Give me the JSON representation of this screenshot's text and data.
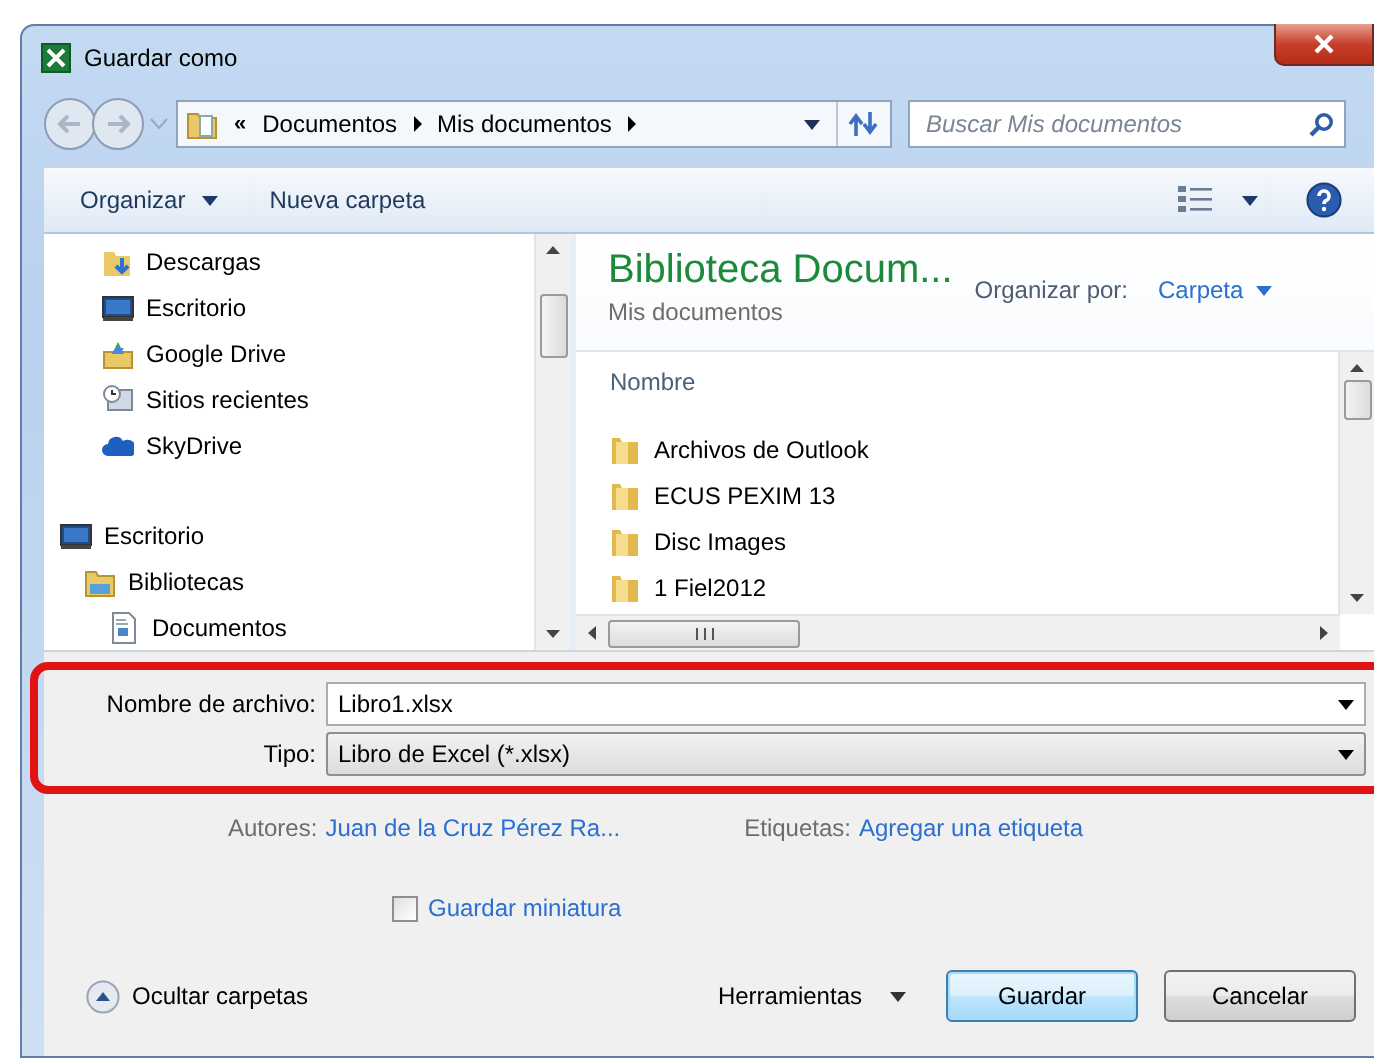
{
  "window": {
    "title": "Guardar como"
  },
  "address_bar": {
    "path": [
      "Documentos",
      "Mis documentos"
    ],
    "overflow": "«"
  },
  "search": {
    "placeholder": "Buscar Mis documentos"
  },
  "toolbar": {
    "organize": "Organizar",
    "new_folder": "Nueva carpeta"
  },
  "nav_favorites": [
    {
      "label": "Descargas",
      "kind": "downloads"
    },
    {
      "label": "Escritorio",
      "kind": "desktop"
    },
    {
      "label": "Google Drive",
      "kind": "drive"
    },
    {
      "label": "Sitios recientes",
      "kind": "recent"
    },
    {
      "label": "SkyDrive",
      "kind": "cloud"
    }
  ],
  "nav_tree": [
    {
      "label": "Escritorio",
      "kind": "desktop",
      "children": [
        {
          "label": "Bibliotecas",
          "kind": "library",
          "children": [
            {
              "label": "Documentos",
              "kind": "document"
            }
          ]
        }
      ]
    }
  ],
  "library": {
    "title": "Biblioteca Docum...",
    "subtitle": "Mis documentos",
    "arrange_label": "Organizar por:",
    "arrange_value": "Carpeta"
  },
  "file_list": {
    "column": "Nombre",
    "items": [
      {
        "name": "Archivos de Outlook",
        "kind": "folder"
      },
      {
        "name": "ECUS PEXIM 13",
        "kind": "folder"
      },
      {
        "name": "Disc Images",
        "kind": "folder"
      },
      {
        "name": "1 Fiel2012",
        "kind": "folder"
      }
    ]
  },
  "file_name": {
    "label": "Nombre de archivo:",
    "value": "Libro1.xlsx"
  },
  "file_type": {
    "label": "Tipo:",
    "value": "Libro de Excel (*.xlsx)"
  },
  "metadata": [
    {
      "label": "Autores:",
      "value": "Juan de la Cruz Pérez Ra..."
    },
    {
      "label": "Etiquetas:",
      "value": "Agregar una etiqueta"
    }
  ],
  "thumbnail": {
    "label": "Guardar miniatura",
    "checked": false
  },
  "hide_folders": "Ocultar carpetas",
  "tools": "Herramientas",
  "buttons": [
    {
      "label": "Guardar",
      "default": true
    },
    {
      "label": "Cancelar",
      "default": false
    }
  ]
}
